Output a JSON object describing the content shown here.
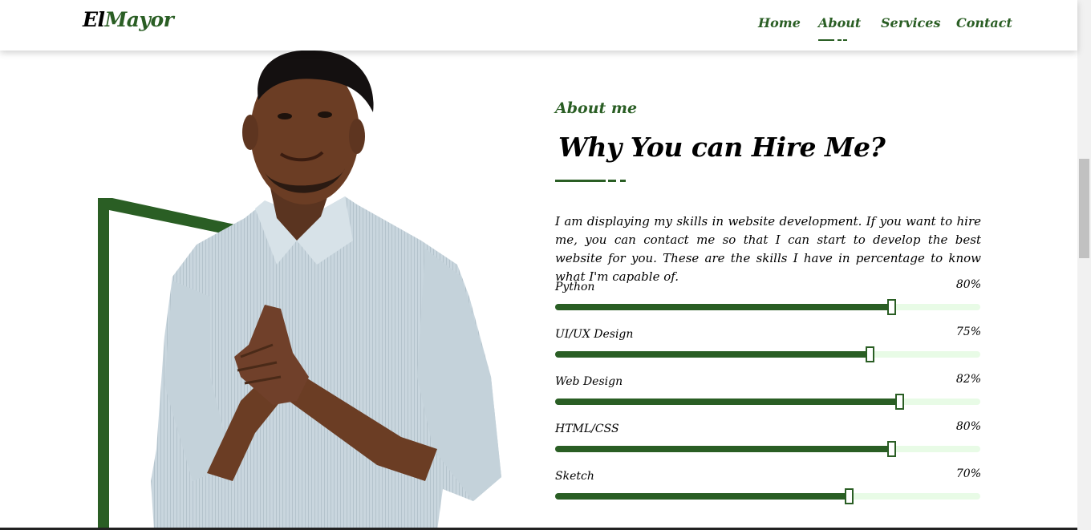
{
  "brand": {
    "logo_part1": "El",
    "logo_part2": "Mayor"
  },
  "nav": {
    "items": [
      {
        "label": "Home"
      },
      {
        "label": "About",
        "active": true
      },
      {
        "label": "Services"
      },
      {
        "label": "Contact"
      }
    ]
  },
  "about": {
    "subtitle": "About me",
    "title": "Why You can Hire Me?",
    "description": "I am displaying my skills in website development. If you want to hire me, you can contact me so that I can start to develop the best website for you. These are the skills I have in percentage to know what I'm capable of."
  },
  "skills": [
    {
      "name": "Python",
      "percent_label": "80%",
      "level": 0.79
    },
    {
      "name": "UI/UX Design",
      "percent_label": "75%",
      "level": 0.74
    },
    {
      "name": "Web Design",
      "percent_label": "82%",
      "level": 0.81
    },
    {
      "name": "HTML/CSS",
      "percent_label": "80%",
      "level": 0.79
    },
    {
      "name": "Sketch",
      "percent_label": "70%",
      "level": 0.69
    }
  ],
  "colors": {
    "accent": "#2a5e24",
    "track": "#e8fbe6"
  },
  "image": {
    "subject": "portrait-of-man-in-striped-shirt"
  }
}
